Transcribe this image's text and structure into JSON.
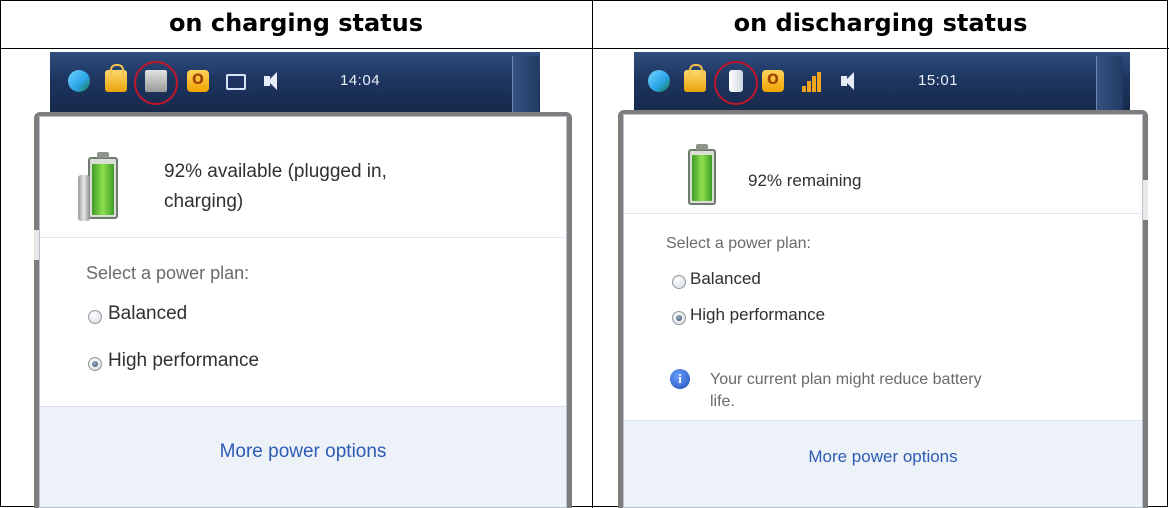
{
  "columns": {
    "left_title": "on charging status",
    "right_title": "on discharging status"
  },
  "charging": {
    "taskbar": {
      "clock": "14:04",
      "icons": [
        "network-icon",
        "lock-icon",
        "power-plug-icon",
        "office-icon",
        "screen-icon",
        "volume-icon"
      ],
      "highlighted_icon": "power-plug-icon"
    },
    "status_line1": "92% available (plugged in,",
    "status_line2": "charging)",
    "plan_heading": "Select a power plan:",
    "plans": [
      {
        "label": "Balanced",
        "selected": false
      },
      {
        "label": "High performance",
        "selected": true
      }
    ],
    "more_link": "More power options"
  },
  "discharging": {
    "taskbar": {
      "clock": "15:01",
      "icons": [
        "network-icon",
        "lock-icon",
        "battery-icon",
        "office-icon",
        "signal-icon",
        "volume-icon"
      ],
      "highlighted_icon": "battery-icon"
    },
    "status_text": "92% remaining",
    "plan_heading": "Select a power plan:",
    "plans": [
      {
        "label": "Balanced",
        "selected": false
      },
      {
        "label": "High performance",
        "selected": true
      }
    ],
    "warning_line1": "Your current plan might reduce battery",
    "warning_line2": "life.",
    "more_link": "More power options"
  },
  "battery_level_percent": 92,
  "colors": {
    "taskbar": "#1e3560",
    "link": "#2e5cb3",
    "highlight_ring": "#c0162c",
    "battery_fill": "#5fc23a"
  }
}
